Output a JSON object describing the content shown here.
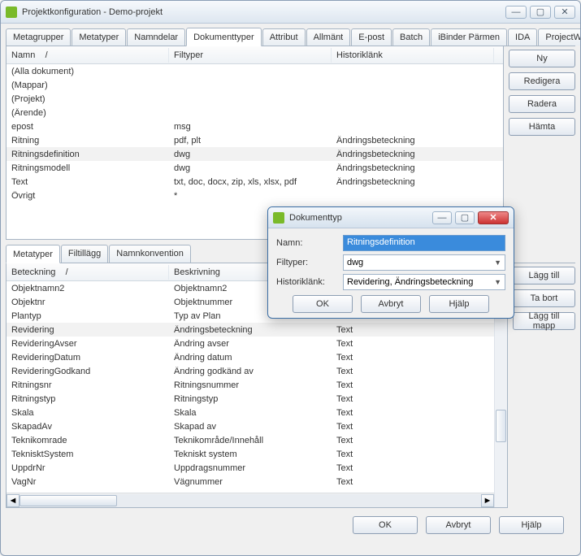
{
  "window": {
    "title": "Projektkonfiguration - Demo-projekt"
  },
  "tabs": [
    "Metagrupper",
    "Metatyper",
    "Namndelar",
    "Dokumenttyper",
    "Attribut",
    "Allmänt",
    "E-post",
    "Batch",
    "iBinder Pärmen",
    "IDA",
    "ProjectWise"
  ],
  "activeTab": "Dokumenttyper",
  "topGrid": {
    "headers": {
      "name": "Namn",
      "filetypes": "Filtyper",
      "history": "Historiklänk"
    },
    "rows": [
      {
        "name": "(Alla dokument)",
        "filetypes": "",
        "history": ""
      },
      {
        "name": "(Mappar)",
        "filetypes": "",
        "history": ""
      },
      {
        "name": "(Projekt)",
        "filetypes": "",
        "history": ""
      },
      {
        "name": "(Ärende)",
        "filetypes": "",
        "history": ""
      },
      {
        "name": "epost",
        "filetypes": "msg",
        "history": ""
      },
      {
        "name": "Ritning",
        "filetypes": "pdf, plt",
        "history": "Ändringsbeteckning"
      },
      {
        "name": "Ritningsdefinition",
        "filetypes": "dwg",
        "history": "Ändringsbeteckning",
        "selected": true
      },
      {
        "name": "Ritningsmodell",
        "filetypes": "dwg",
        "history": "Ändringsbeteckning"
      },
      {
        "name": "Text",
        "filetypes": "txt, doc, docx, zip, xls, xlsx, pdf",
        "history": "Ändringsbeteckning"
      },
      {
        "name": "Övrigt",
        "filetypes": "*",
        "history": ""
      }
    ]
  },
  "topButtons": {
    "new": "Ny",
    "edit": "Redigera",
    "delete": "Radera",
    "fetch": "Hämta"
  },
  "subTabs": [
    "Metatyper",
    "Filtillägg",
    "Namnkonvention"
  ],
  "activeSubTab": "Metatyper",
  "metaGrid": {
    "headers": {
      "code": "Beteckning",
      "desc": "Beskrivning",
      "type": ""
    },
    "rows": [
      {
        "code": "Objektnamn2",
        "desc": "Objektnamn2",
        "type": "Text"
      },
      {
        "code": "Objektnr",
        "desc": "Objektnummer",
        "type": "Text"
      },
      {
        "code": "Plantyp",
        "desc": "Typ av Plan",
        "type": "Text"
      },
      {
        "code": "Revidering",
        "desc": "Ändringsbeteckning",
        "type": "Text",
        "selected": true
      },
      {
        "code": "RevideringAvser",
        "desc": "Ändring avser",
        "type": "Text"
      },
      {
        "code": "RevideringDatum",
        "desc": "Ändring datum",
        "type": "Text"
      },
      {
        "code": "RevideringGodkand",
        "desc": "Ändring godkänd av",
        "type": "Text"
      },
      {
        "code": "Ritningsnr",
        "desc": "Ritningsnummer",
        "type": "Text"
      },
      {
        "code": "Ritningstyp",
        "desc": "Ritningstyp",
        "type": "Text"
      },
      {
        "code": "Skala",
        "desc": "Skala",
        "type": "Text"
      },
      {
        "code": "SkapadAv",
        "desc": "Skapad av",
        "type": "Text"
      },
      {
        "code": "Teknikomrade",
        "desc": "Teknikområde/Innehåll",
        "type": "Text"
      },
      {
        "code": "TeknisktSystem",
        "desc": "Tekniskt system",
        "type": "Text"
      },
      {
        "code": "UppdrNr",
        "desc": "Uppdragsnummer",
        "type": "Text"
      },
      {
        "code": "VagNr",
        "desc": "Vägnummer",
        "type": "Text"
      }
    ]
  },
  "metaButtons": {
    "add": "Lägg till",
    "remove": "Ta bort",
    "addFolder": "Lägg till mapp"
  },
  "dialog": {
    "title": "Dokumenttyp",
    "labels": {
      "name": "Namn:",
      "filetypes": "Filtyper:",
      "history": "Historiklänk:"
    },
    "values": {
      "name": "Ritningsdefinition",
      "filetypes": "dwg",
      "history": "Revidering, Ändringsbeteckning"
    },
    "buttons": {
      "ok": "OK",
      "cancel": "Avbryt",
      "help": "Hjälp"
    }
  },
  "footer": {
    "ok": "OK",
    "cancel": "Avbryt",
    "help": "Hjälp"
  }
}
